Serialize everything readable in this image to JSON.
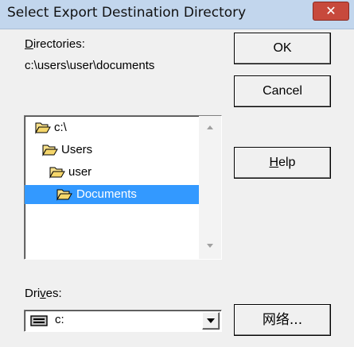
{
  "window": {
    "title": "Select Export Destination Directory",
    "close_glyph": "✕"
  },
  "directories": {
    "label_mnemonic": "D",
    "label_rest": "irectories:",
    "current_path": "c:\\users\\user\\documents",
    "tree": [
      {
        "label": "c:\\",
        "icon": "open-folder-icon"
      },
      {
        "label": "Users",
        "icon": "open-folder-icon"
      },
      {
        "label": "user",
        "icon": "open-folder-icon"
      },
      {
        "label": "Documents",
        "icon": "open-folder-icon",
        "selected": true
      }
    ]
  },
  "drives": {
    "label_pre": "Dri",
    "label_mnemonic": "v",
    "label_post": "es:",
    "selected": "c:",
    "icon": "drive-icon"
  },
  "buttons": {
    "ok": "OK",
    "cancel": "Cancel",
    "help_mnemonic": "H",
    "help_rest": "elp",
    "network": "网络..."
  },
  "colors": {
    "selection": "#3399ff",
    "title_bar": "#c2d6ed",
    "close": "#c7493c",
    "folder": "#f5d66b"
  }
}
